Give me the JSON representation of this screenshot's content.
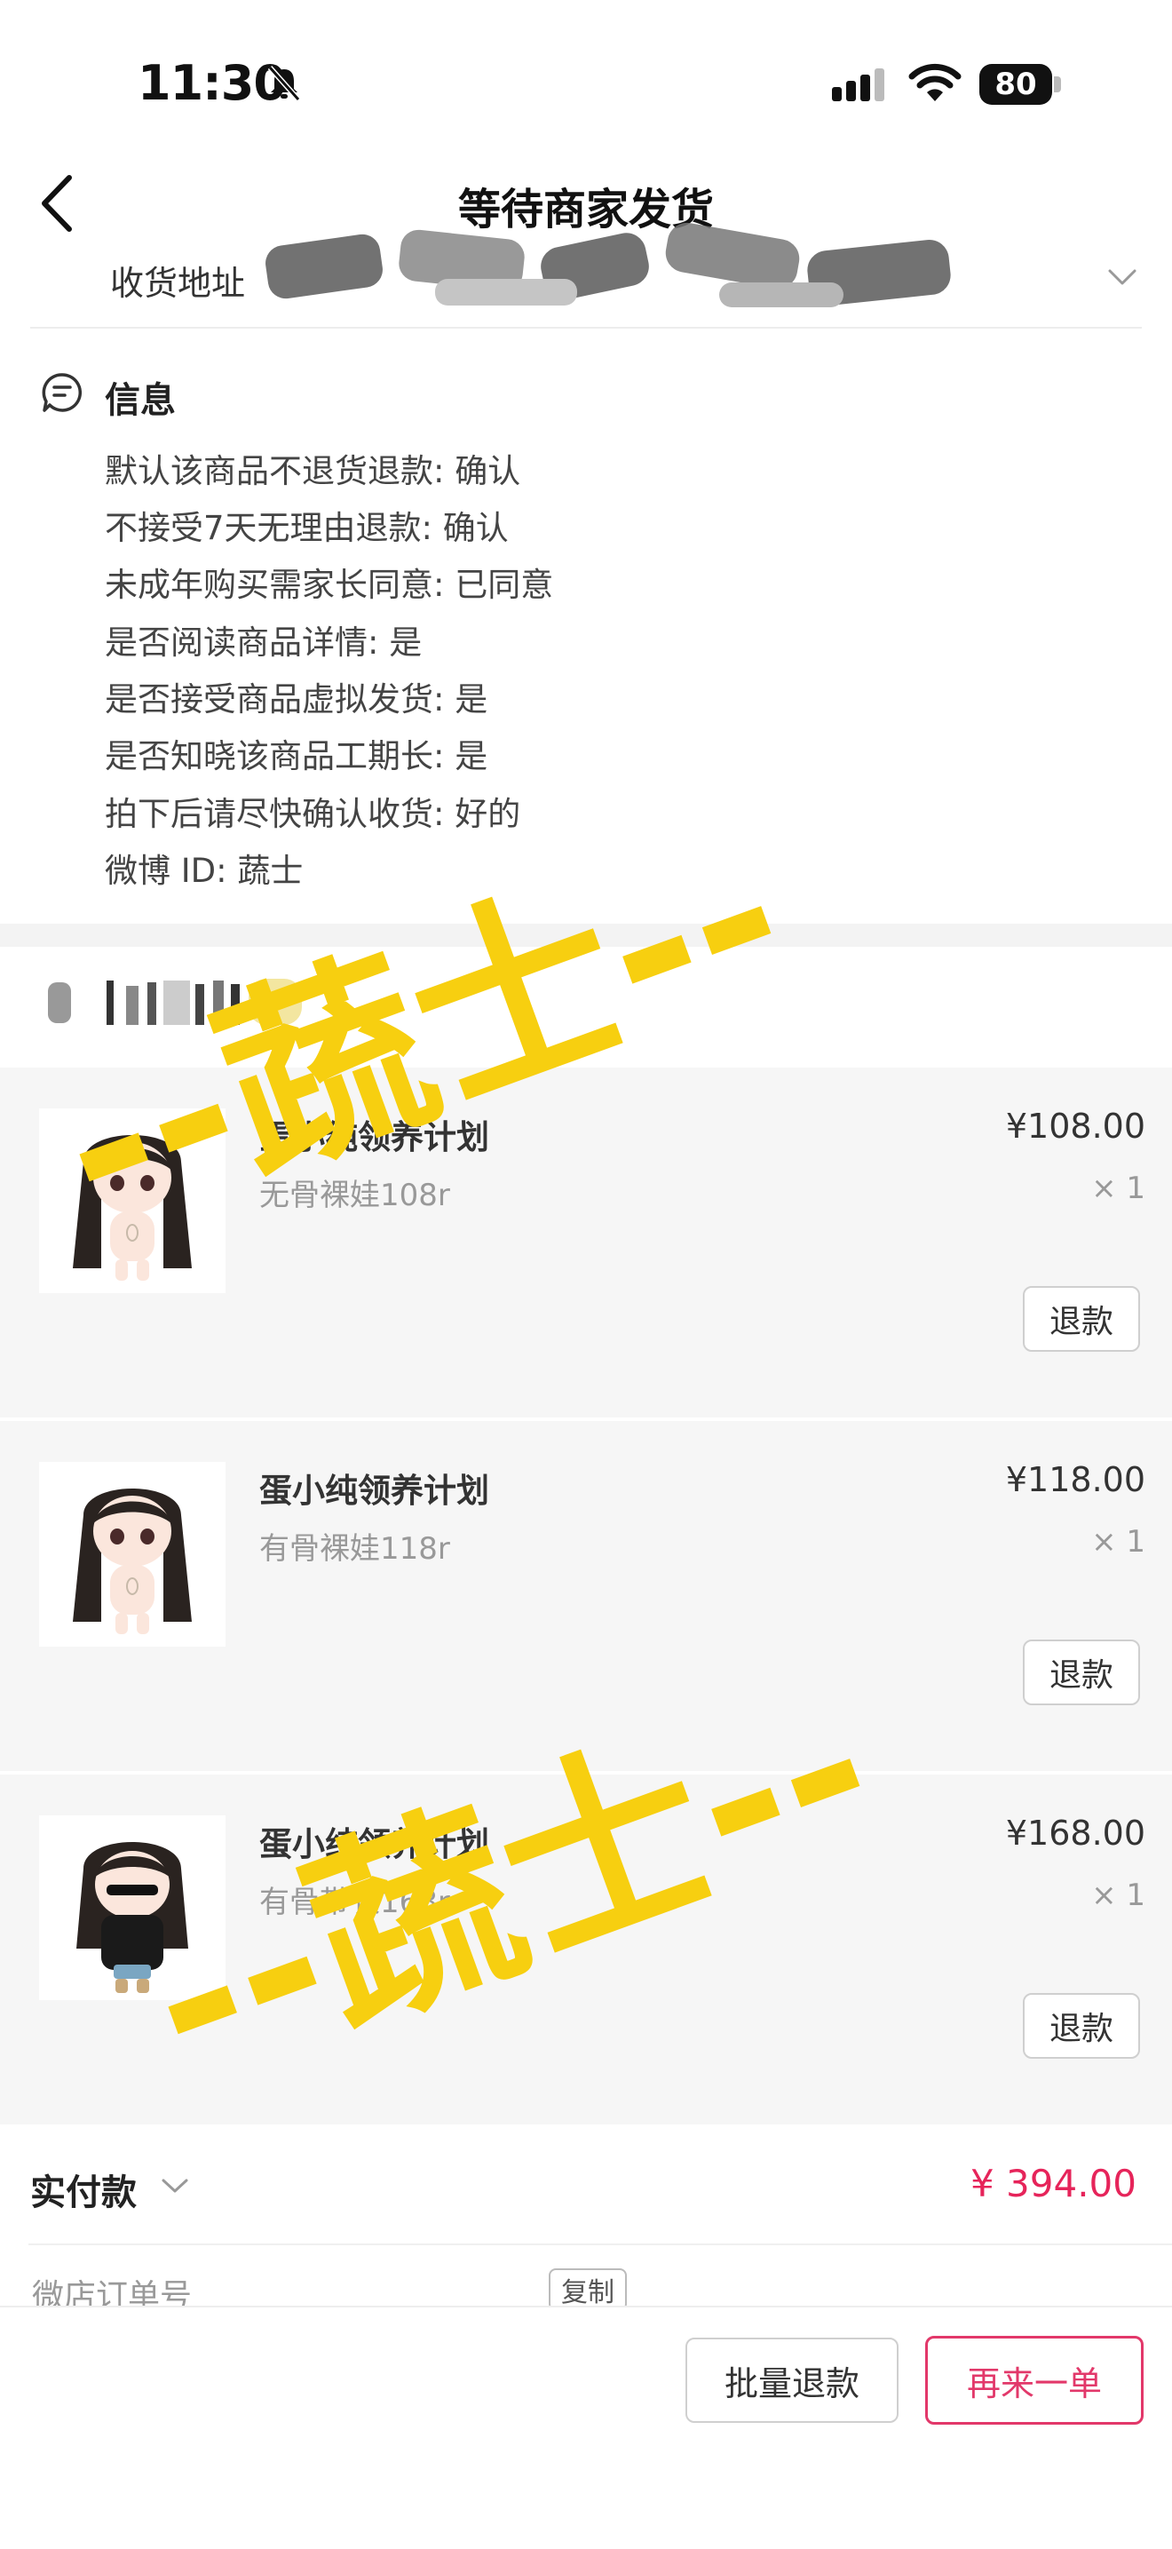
{
  "status_bar": {
    "time": "11:30",
    "battery": "80"
  },
  "header": {
    "title": "等待商家发货"
  },
  "address": {
    "label": "收货地址"
  },
  "info": {
    "title": "信息",
    "lines": [
      "默认该商品不退货退款: 确认",
      "不接受7天无理由退款: 确认",
      "未成年购买需家长同意: 已同意",
      "是否阅读商品详情: 是",
      "是否接受商品虚拟发货: 是",
      "是否知晓该商品工期长: 是",
      "拍下后请尽快确认收货: 好的",
      "微博 ID: 蔬士"
    ]
  },
  "items": [
    {
      "name": "蛋小纯领养计划",
      "spec": "无骨裸娃108r",
      "price": "¥108.00",
      "qty": "× 1",
      "refund_label": "退款"
    },
    {
      "name": "蛋小纯领养计划",
      "spec": "有骨裸娃118r",
      "price": "¥118.00",
      "qty": "× 1",
      "refund_label": "退款"
    },
    {
      "name": "蛋小纯领养计划",
      "spec": "有骨带衣168r",
      "price": "¥168.00",
      "qty": "× 1",
      "refund_label": "退款"
    }
  ],
  "payment": {
    "label": "实付款",
    "amount": "¥ 394.00"
  },
  "order": {
    "label": "微店订单号",
    "copy_label": "复制"
  },
  "actions": {
    "batch_refund": "批量退款",
    "reorder": "再来一单"
  },
  "watermark": {
    "text": "--蔬士--"
  },
  "colors": {
    "accent": "#e2386a",
    "watermark": "#f7cf10"
  }
}
